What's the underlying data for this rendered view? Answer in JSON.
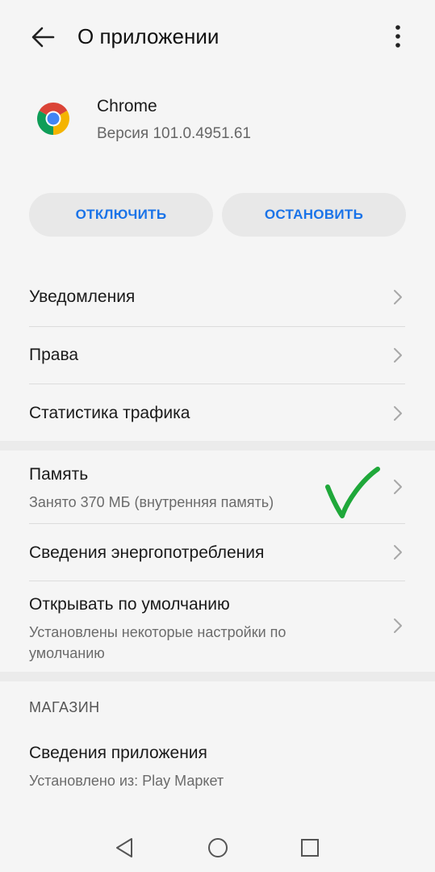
{
  "header": {
    "title": "О приложении",
    "back_icon": "arrow-left-icon",
    "more_icon": "more-vertical-icon"
  },
  "app": {
    "name": "Chrome",
    "version": "Версия 101.0.4951.61",
    "icon": "chrome-logo-icon"
  },
  "actions": {
    "disable_label": "ОТКЛЮЧИТЬ",
    "stop_label": "ОСТАНОВИТЬ",
    "accent_color": "#1a73e8"
  },
  "settings": {
    "notifications": "Уведомления",
    "permissions": "Права",
    "traffic": "Статистика трафика",
    "storage": {
      "label": "Память",
      "sub": "Занято 370 МБ (внутренняя память)"
    },
    "battery": "Сведения энергопотребления",
    "defaults": {
      "label": "Открывать по умолчанию",
      "sub": "Установлены некоторые настройки по умолчанию"
    }
  },
  "store": {
    "section_title": "МАГАЗИН",
    "app_details": {
      "label": "Сведения приложения",
      "sub": "Установлено из: Play Маркет"
    }
  },
  "annotation": {
    "checkmark_color": "#1fa83a"
  },
  "navbar": {
    "icons": [
      "back-triangle-icon",
      "home-circle-icon",
      "recents-square-icon"
    ]
  }
}
